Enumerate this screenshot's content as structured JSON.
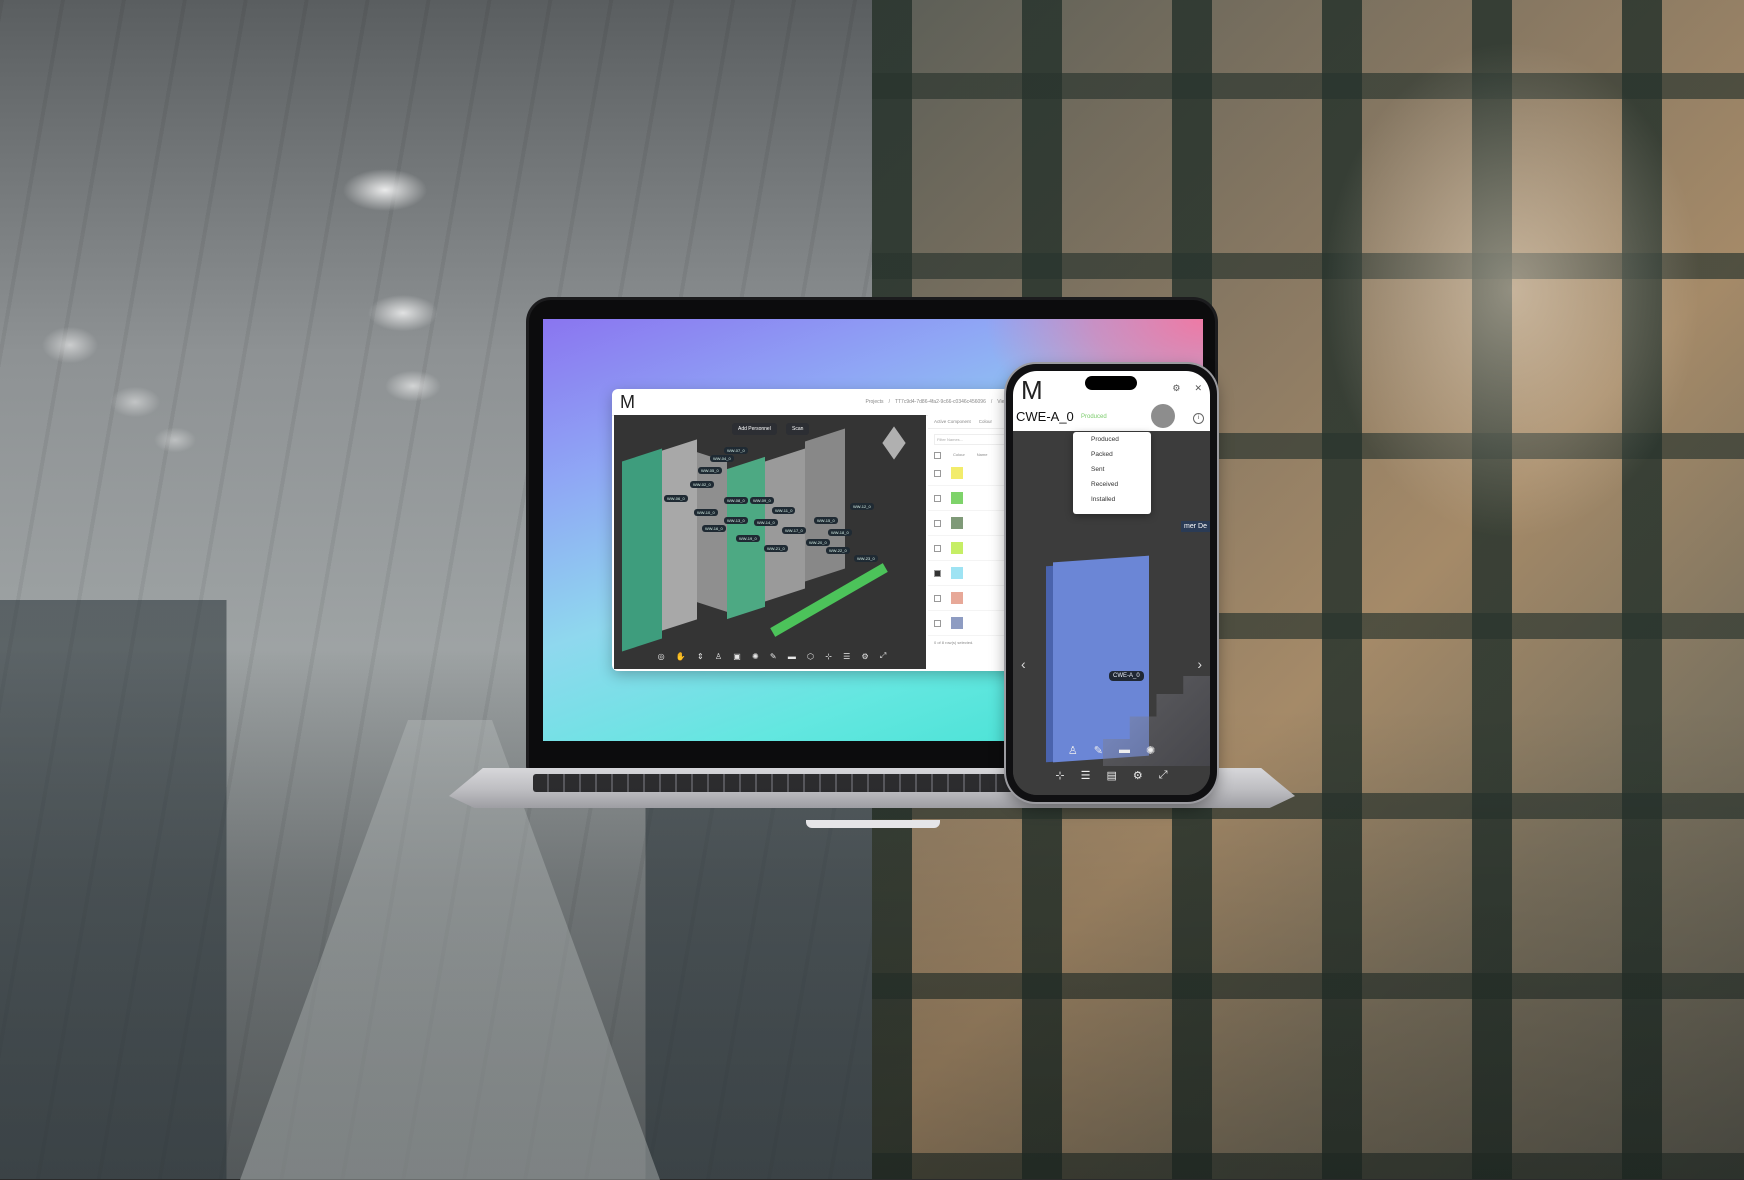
{
  "desktop_app": {
    "logo": "M",
    "breadcrumb": [
      "Projects",
      "TT7c9d4-7d86-4fa2-9c66-c0346c456096",
      "View"
    ],
    "buttons": {
      "add_personnel": "Add Personnel",
      "scan": "Scan"
    },
    "side_panel": {
      "tabs": [
        "Active Component",
        "Colour"
      ],
      "filter_placeholder": "Filter Names...",
      "columns": [
        "Colour",
        "Name"
      ],
      "rows": [
        {
          "color": "#f2ec6b",
          "checked": false
        },
        {
          "color": "#7ed36a",
          "checked": false
        },
        {
          "color": "#7f9a78",
          "checked": false
        },
        {
          "color": "#c6ee65",
          "checked": false
        },
        {
          "color": "#9ee3f3",
          "checked": true
        },
        {
          "color": "#e7a898",
          "checked": false
        },
        {
          "color": "#8e9cc2",
          "checked": false
        }
      ],
      "footer": "0 of 8 row(s) selected."
    },
    "labels": [
      "WW-04_0",
      "WW-05_0",
      "WW-07_0",
      "WW-02_0",
      "WW-06_0",
      "WW-08_0",
      "WW-09_0",
      "WW-10_0",
      "WW-11_0",
      "WW-12_0",
      "WW-13_0",
      "WW-14_0",
      "WW-15_0",
      "WW-16_0",
      "WW-17_0",
      "WW-18_0",
      "WW-19_0",
      "WW-20_0",
      "WW-21_0",
      "WW-22_0",
      "WW-23_0"
    ]
  },
  "phone_app": {
    "logo": "M",
    "title": "CWE-A_0",
    "status": "Produced",
    "side_label": "mer De",
    "status_options": [
      "Produced",
      "Packed",
      "Sent",
      "Received",
      "Installed"
    ],
    "element_label": "CWE-A_0",
    "nav_prev": "‹",
    "nav_next": "›",
    "info_icon": "i"
  }
}
